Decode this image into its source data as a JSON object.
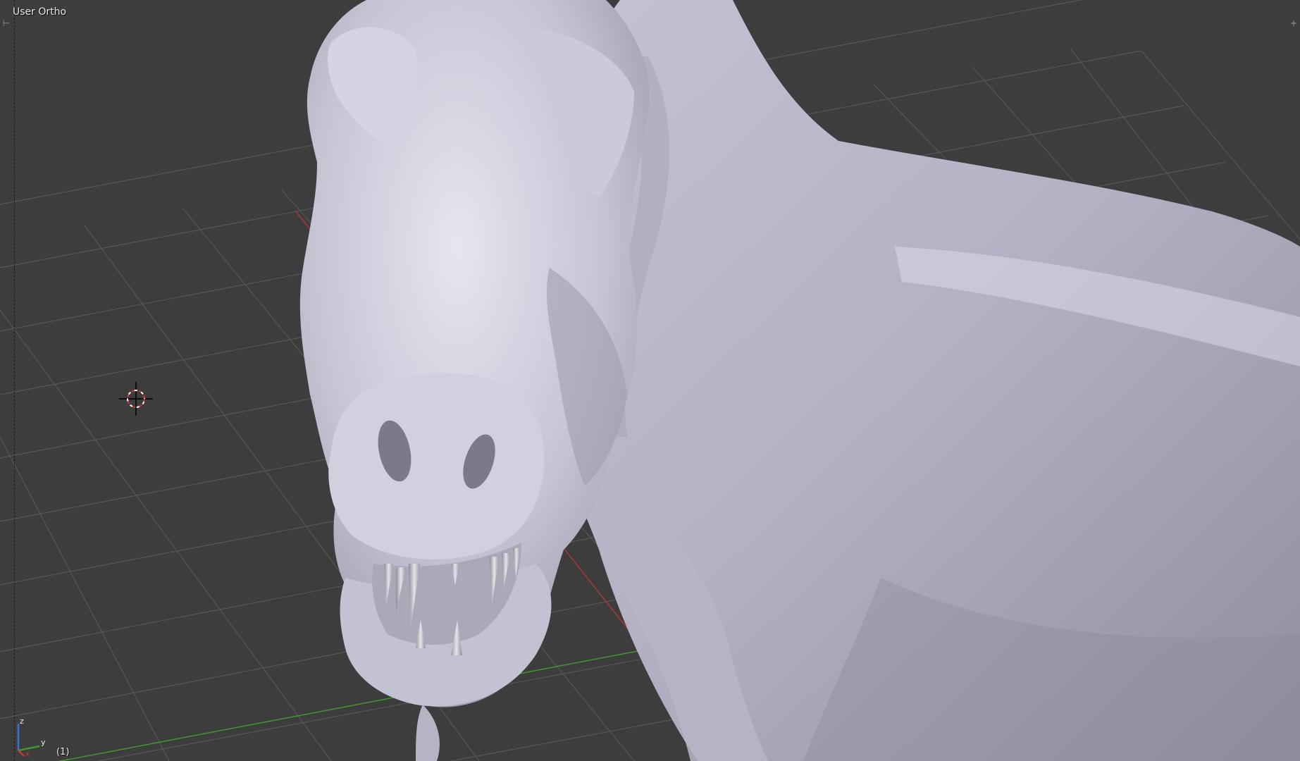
{
  "viewport": {
    "view_label": "User Ortho",
    "frame_label": "(1)",
    "axis_labels": {
      "x": "x",
      "y": "y",
      "z": "z"
    },
    "colors": {
      "background": "#3d3d3d",
      "grid": "#555555",
      "x_axis": "#a33a3a",
      "y_axis": "#3f9a2e",
      "model": "#c9c9d9",
      "cursor_ring": "#c8373a"
    }
  }
}
